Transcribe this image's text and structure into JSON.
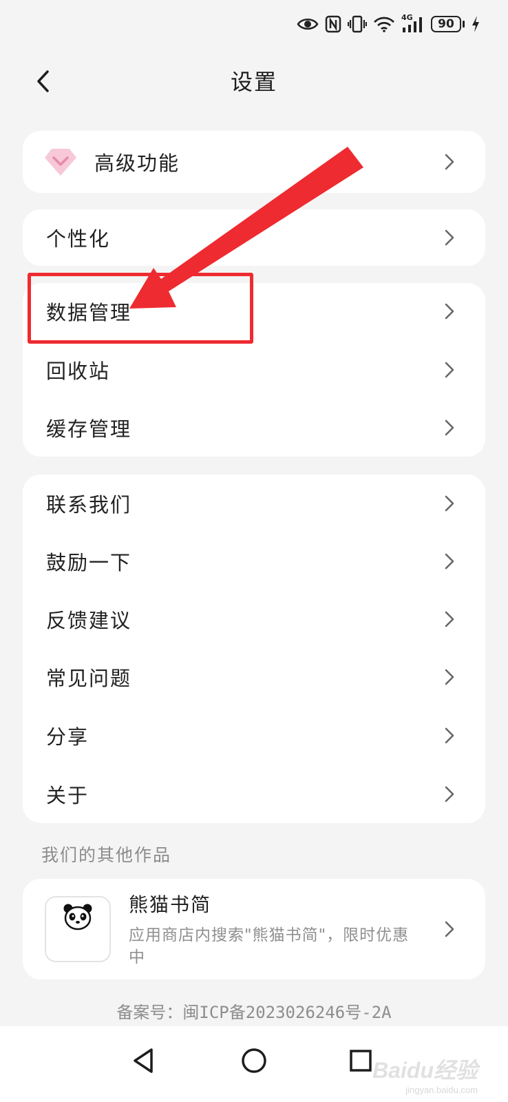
{
  "status_bar": {
    "icons": [
      "eye-icon",
      "nfc-icon",
      "vibrate-icon",
      "wifi-icon",
      "signal-4g-icon",
      "battery-icon",
      "charging-icon"
    ],
    "network_label": "4G",
    "battery_level": "90"
  },
  "header": {
    "title": "设置",
    "back_icon": "chevron-left-icon"
  },
  "premium_card": {
    "icon": "diamond-icon",
    "label": "高级功能"
  },
  "personalize_card": {
    "label": "个性化"
  },
  "data_card": {
    "items": [
      {
        "label": "数据管理"
      },
      {
        "label": "回收站"
      },
      {
        "label": "缓存管理"
      }
    ]
  },
  "support_card": {
    "items": [
      {
        "label": "联系我们"
      },
      {
        "label": "鼓励一下"
      },
      {
        "label": "反馈建议"
      },
      {
        "label": "常见问题"
      },
      {
        "label": "分享"
      },
      {
        "label": "关于"
      }
    ]
  },
  "other_works": {
    "section_label": "我们的其他作品",
    "app": {
      "icon": "panda-icon",
      "name": "熊猫书简",
      "description": "应用商店内搜索\"熊猫书简\"，限时优惠中"
    }
  },
  "footer": {
    "icp": "备案号：闽ICP备2023026246号-2A"
  },
  "nav_bar": {
    "buttons": [
      "back-triangle-icon",
      "home-circle-icon",
      "recents-square-icon"
    ]
  },
  "watermark": {
    "logo": "Baidu经验",
    "url": "jingyan.baidu.com"
  },
  "colors": {
    "background": "#f4f4f5",
    "card": "#ffffff",
    "annotation_red": "#ee2b30",
    "diamond_pink": "#f7c8d8",
    "secondary_text": "#8c8c8c"
  }
}
